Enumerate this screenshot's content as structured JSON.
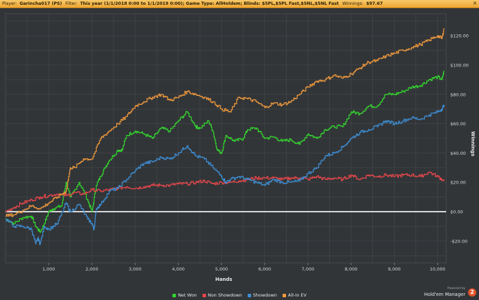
{
  "header": {
    "player_label": "Player:",
    "player_value": "Garincha017 (PS)",
    "filter_label": "Filter:",
    "filter_value": "This year (1/1/2018 0:00 to 1/1/2019 0:00); Game Type: AllHoldem; Blinds: $5PL,$5PL Fast,$5NL,$5NL Fast",
    "winnings_label": "Winnings:",
    "winnings_value": "$97.67",
    "close_glyph": "×"
  },
  "branding": {
    "powered_by": "Powered by",
    "name": "Hold'em Manager",
    "badge": "2"
  },
  "colors": {
    "background": "#323538",
    "grid": "#46494c",
    "zero_line": "#ffffff",
    "net_won": "#33d62e",
    "non_showdown": "#e8474a",
    "showdown": "#3d8fd6",
    "all_in_ev": "#f19a3c"
  },
  "chart_data": {
    "type": "line",
    "xlabel": "Hands",
    "ylabel": "Winnings",
    "xlim": [
      0,
      10200
    ],
    "ylim": [
      -35,
      135
    ],
    "x_ticks": [
      1000,
      2000,
      3000,
      4000,
      5000,
      6000,
      7000,
      8000,
      9000,
      10000
    ],
    "x_tick_labels": [
      "1,000",
      "2,000",
      "3,000",
      "4,000",
      "5,000",
      "6,000",
      "7,000",
      "8,000",
      "9,000",
      "10,000"
    ],
    "y_ticks": [
      -20,
      0,
      20,
      40,
      60,
      80,
      100,
      120
    ],
    "y_tick_labels": [
      "-$20.00",
      "$0.00",
      "$20.00",
      "$40.00",
      "$60.00",
      "$80.00",
      "$100.00",
      "$120.00"
    ],
    "grid": true,
    "legend_position": "bottom",
    "series": [
      {
        "name": "Net Won",
        "color": "#33d62e",
        "x": [
          0,
          200,
          400,
          600,
          700,
          800,
          900,
          1000,
          1100,
          1300,
          1400,
          1500,
          1700,
          1900,
          2000,
          2100,
          2200,
          2300,
          2400,
          2600,
          2700,
          2800,
          3000,
          3200,
          3400,
          3600,
          3800,
          4000,
          4200,
          4400,
          4500,
          4700,
          4800,
          4900,
          5000,
          5100,
          5300,
          5500,
          5600,
          5800,
          6000,
          6200,
          6400,
          6600,
          6800,
          7000,
          7200,
          7400,
          7600,
          7800,
          8000,
          8200,
          8400,
          8600,
          8800,
          9000,
          9200,
          9400,
          9600,
          9800,
          10000,
          10100,
          10150
        ],
        "y": [
          -5,
          -8,
          -4,
          -3,
          -10,
          -14,
          -8,
          0,
          2,
          4,
          20,
          10,
          20,
          8,
          0,
          18,
          24,
          30,
          35,
          42,
          42,
          52,
          55,
          53,
          50,
          57,
          55,
          62,
          68,
          58,
          57,
          62,
          55,
          42,
          40,
          52,
          48,
          50,
          56,
          57,
          50,
          51,
          48,
          49,
          46,
          53,
          50,
          56,
          58,
          58,
          68,
          67,
          72,
          72,
          80,
          80,
          82,
          85,
          86,
          90,
          92,
          90,
          96
        ]
      },
      {
        "name": "Non Showdown",
        "color": "#e8474a",
        "x": [
          0,
          200,
          400,
          600,
          800,
          1000,
          1200,
          1400,
          1600,
          1800,
          2000,
          2200,
          2400,
          2600,
          2800,
          3000,
          3200,
          3400,
          3600,
          3800,
          4000,
          4200,
          4400,
          4600,
          4800,
          5000,
          5200,
          5400,
          5600,
          5800,
          6000,
          6200,
          6400,
          6600,
          6800,
          7000,
          7200,
          7400,
          7600,
          7800,
          8000,
          8200,
          8400,
          8600,
          8800,
          9000,
          9200,
          9400,
          9600,
          9800,
          10000,
          10150
        ],
        "y": [
          0,
          3,
          6,
          8,
          10,
          11,
          12,
          11,
          13,
          12,
          15,
          14,
          15,
          16,
          17,
          16,
          17,
          18,
          18,
          18,
          19,
          19,
          20,
          21,
          19,
          20,
          20,
          21,
          22,
          23,
          23,
          23,
          22,
          23,
          23,
          22,
          24,
          22,
          23,
          22,
          25,
          22,
          25,
          24,
          25,
          24,
          25,
          25,
          24,
          27,
          24,
          21
        ]
      },
      {
        "name": "Showdown",
        "color": "#3d8fd6",
        "x": [
          0,
          200,
          400,
          600,
          700,
          750,
          800,
          900,
          1000,
          1200,
          1400,
          1500,
          1700,
          1900,
          2000,
          2050,
          2100,
          2200,
          2400,
          2600,
          2800,
          3000,
          3200,
          3400,
          3600,
          3800,
          4000,
          4200,
          4400,
          4600,
          4800,
          5000,
          5100,
          5200,
          5400,
          5600,
          5800,
          6000,
          6200,
          6400,
          6600,
          6800,
          7000,
          7200,
          7400,
          7600,
          7800,
          8000,
          8200,
          8400,
          8600,
          8800,
          9000,
          9200,
          9400,
          9600,
          9800,
          10000,
          10100,
          10150
        ],
        "y": [
          -5,
          -10,
          -10,
          -12,
          -22,
          -18,
          -22,
          -10,
          -12,
          -8,
          6,
          0,
          5,
          -5,
          -8,
          -12,
          2,
          5,
          14,
          16,
          22,
          28,
          33,
          34,
          37,
          36,
          40,
          45,
          38,
          36,
          30,
          24,
          20,
          22,
          24,
          22,
          20,
          18,
          22,
          20,
          20,
          21,
          26,
          30,
          38,
          40,
          44,
          50,
          54,
          56,
          58,
          62,
          60,
          62,
          64,
          63,
          66,
          68,
          70,
          73
        ]
      },
      {
        "name": "All-In EV",
        "color": "#f19a3c",
        "x": [
          0,
          200,
          400,
          600,
          800,
          1000,
          1200,
          1400,
          1500,
          1600,
          1800,
          2000,
          2200,
          2400,
          2600,
          2800,
          3000,
          3200,
          3400,
          3600,
          3800,
          4000,
          4200,
          4400,
          4600,
          4800,
          5000,
          5200,
          5400,
          5600,
          5800,
          6000,
          6200,
          6400,
          6600,
          6800,
          7000,
          7200,
          7400,
          7600,
          7800,
          8000,
          8200,
          8400,
          8600,
          8800,
          9000,
          9200,
          9400,
          9600,
          9800,
          10000,
          10100,
          10150
        ],
        "y": [
          -3,
          -2,
          1,
          4,
          2,
          6,
          10,
          14,
          30,
          30,
          36,
          36,
          50,
          55,
          60,
          65,
          72,
          75,
          78,
          80,
          76,
          78,
          82,
          80,
          78,
          75,
          70,
          68,
          78,
          77,
          75,
          71,
          74,
          73,
          75,
          80,
          85,
          89,
          90,
          93,
          91,
          94,
          98,
          102,
          103,
          106,
          108,
          110,
          112,
          114,
          117,
          120,
          118,
          125
        ]
      }
    ]
  }
}
